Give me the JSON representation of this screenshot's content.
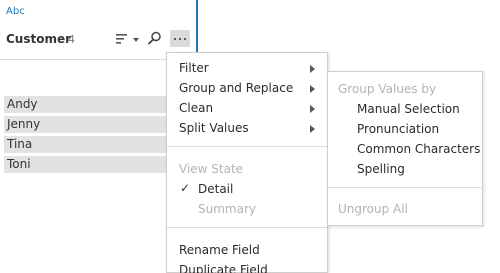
{
  "field_card": {
    "type_label": "Abc",
    "field_name": "Customer",
    "count": "4",
    "values": [
      "Andy",
      "Jenny",
      "Tina",
      "Toni"
    ]
  },
  "main_menu": {
    "filter": "Filter",
    "group_and_replace": "Group and Replace",
    "clean": "Clean",
    "split_values": "Split Values",
    "view_state_header": "View State",
    "detail": "Detail",
    "summary": "Summary",
    "rename_field": "Rename Field",
    "duplicate_field": "Duplicate Field"
  },
  "sub_menu": {
    "header": "Group Values by",
    "manual_selection": "Manual Selection",
    "pronunciation": "Pronunciation",
    "common_characters": "Common Characters",
    "spelling": "Spelling",
    "ungroup_all": "Ungroup All"
  },
  "colors": {
    "accent": "#1f77b4",
    "row_bg": "#e2e2e2",
    "disabled_text": "#b3b3b3"
  },
  "icons": {
    "sort": "sort-icon",
    "search": "search-icon",
    "more": "more-options-icon",
    "check": "check-icon",
    "submenu_arrow": "chevron-right-icon"
  }
}
